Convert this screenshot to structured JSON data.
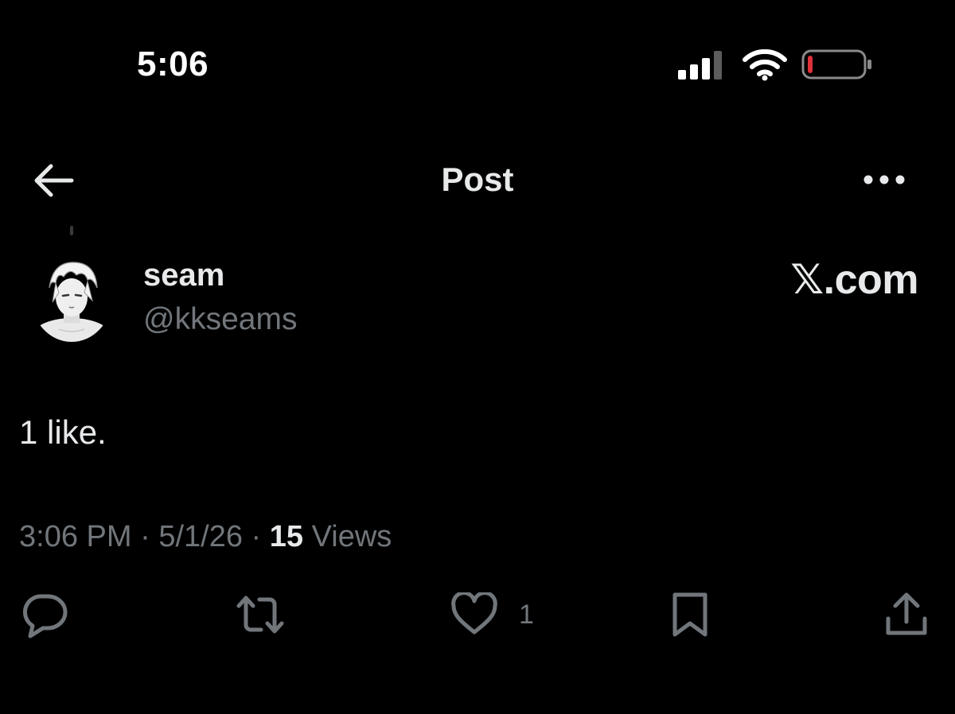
{
  "status_bar": {
    "time": "5:06",
    "icons": [
      "cellular-signal-icon",
      "wifi-icon",
      "battery-low-icon"
    ],
    "battery_level": 0.08,
    "battery_color": "#e0313b"
  },
  "nav": {
    "title": "Post",
    "back_icon": "arrow-left-icon",
    "more_icon": "more-horizontal-icon"
  },
  "post": {
    "author": {
      "display_name": "seam",
      "handle": "@kkseams",
      "avatar_icon": "anime-avatar"
    },
    "brand_mark": "𝕏.com",
    "text": "1 like.",
    "meta": {
      "time": "3:06 PM",
      "separator": "·",
      "date": "5/1/26",
      "views_count": "15",
      "views_label": "Views"
    },
    "actions": {
      "reply_icon": "reply-icon",
      "repost_icon": "repost-icon",
      "like_icon": "heart-icon",
      "like_count": "1",
      "bookmark_icon": "bookmark-icon",
      "share_icon": "share-icon"
    }
  },
  "colors": {
    "background": "#000000",
    "primary_text": "#e7e9ea",
    "secondary_text": "#71767b"
  }
}
